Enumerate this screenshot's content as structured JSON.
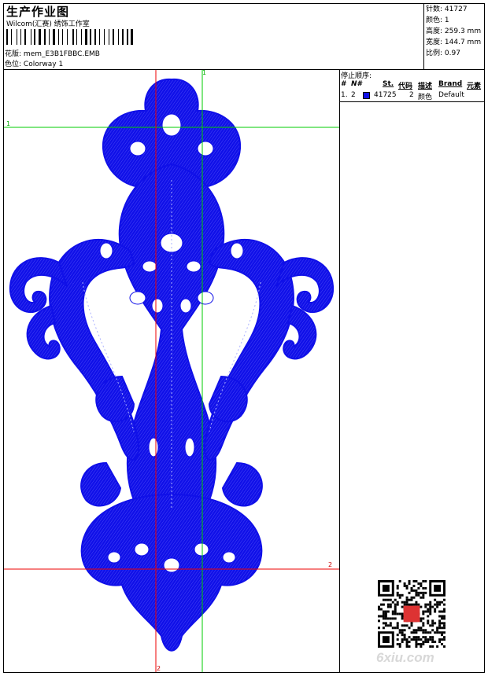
{
  "header": {
    "title": "生产作业图",
    "studio": "Wilcom(汇赛) 绣饰工作室",
    "design_label": "花版:",
    "design_file": "mem_E3B1FBBC.EMB",
    "colorway_label": "色位:",
    "colorway": "Colorway 1"
  },
  "stats": [
    {
      "label": "针数:",
      "value": "41727"
    },
    {
      "label": "颜色:",
      "value": "1"
    },
    {
      "label": "高度:",
      "value": "259.3 mm"
    },
    {
      "label": "宽度:",
      "value": "144.7 mm"
    },
    {
      "label": "比例:",
      "value": "0.97"
    }
  ],
  "stop_sequence": {
    "heading": "停止顺序:",
    "columns": [
      "#",
      "N#",
      "St.",
      "代码",
      "描述",
      "Brand",
      "元素"
    ],
    "rows": [
      {
        "index": "1.",
        "n": "2",
        "stitches": "41725",
        "code": "2",
        "description": "颜色",
        "brand": "Default",
        "color": "#1010e8"
      }
    ]
  },
  "guides": {
    "green_1": "1",
    "green_1b": "1",
    "red_2": "2",
    "red_2b": "2"
  },
  "colors": {
    "thread": "#1010e8",
    "guide_green": "#00cc00",
    "guide_red": "#ee0000"
  },
  "watermark": "6xiu.com"
}
